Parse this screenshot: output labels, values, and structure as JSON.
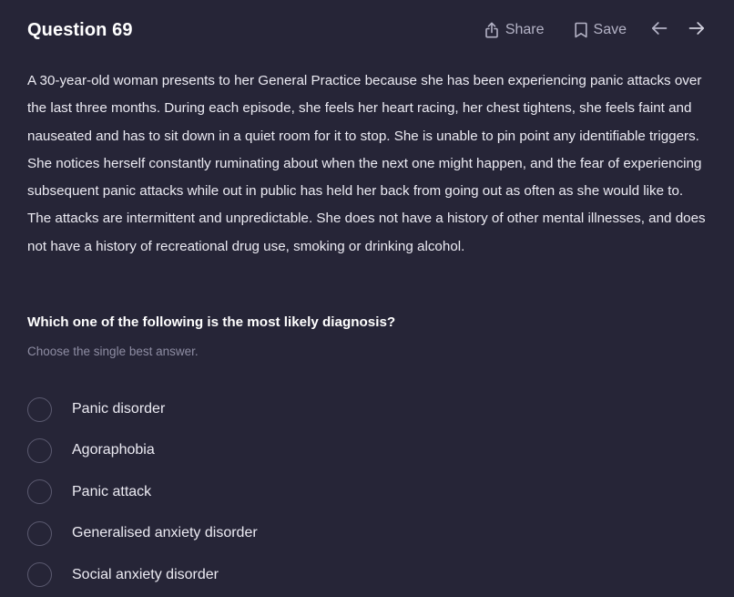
{
  "question": {
    "title": "Question 69",
    "stem": "A 30-year-old woman presents to her General Practice because she has been experiencing panic attacks over the last three months. During each episode, she feels her heart racing, her chest tightens, she feels faint and nauseated and has to sit down in a quiet room for it to stop. She is unable to pin point any identifiable triggers. She notices herself constantly ruminating about when the next one might happen, and the fear of experiencing subsequent panic attacks while out in public has held her back from going out as often as she would like to. The attacks are intermittent and unpredictable. She does not have a history of other mental illnesses, and does not have a history of recreational drug use, smoking or drinking alcohol.",
    "prompt": "Which one of the following is the most likely diagnosis?",
    "instruction": "Choose the single best answer.",
    "options": [
      {
        "label": "Panic disorder"
      },
      {
        "label": "Agoraphobia"
      },
      {
        "label": "Panic attack"
      },
      {
        "label": "Generalised anxiety disorder"
      },
      {
        "label": "Social anxiety disorder"
      }
    ]
  },
  "toolbar": {
    "share_label": "Share",
    "save_label": "Save",
    "share_icon": "share-icon",
    "save_icon": "bookmark-icon",
    "prev_icon": "arrow-left-icon",
    "next_icon": "arrow-right-icon"
  },
  "colors": {
    "background": "#262537",
    "text": "#ecebf3",
    "muted": "#8e8da3",
    "toolbar_text": "#b4b3c6",
    "radio_border": "#5b5a70"
  }
}
